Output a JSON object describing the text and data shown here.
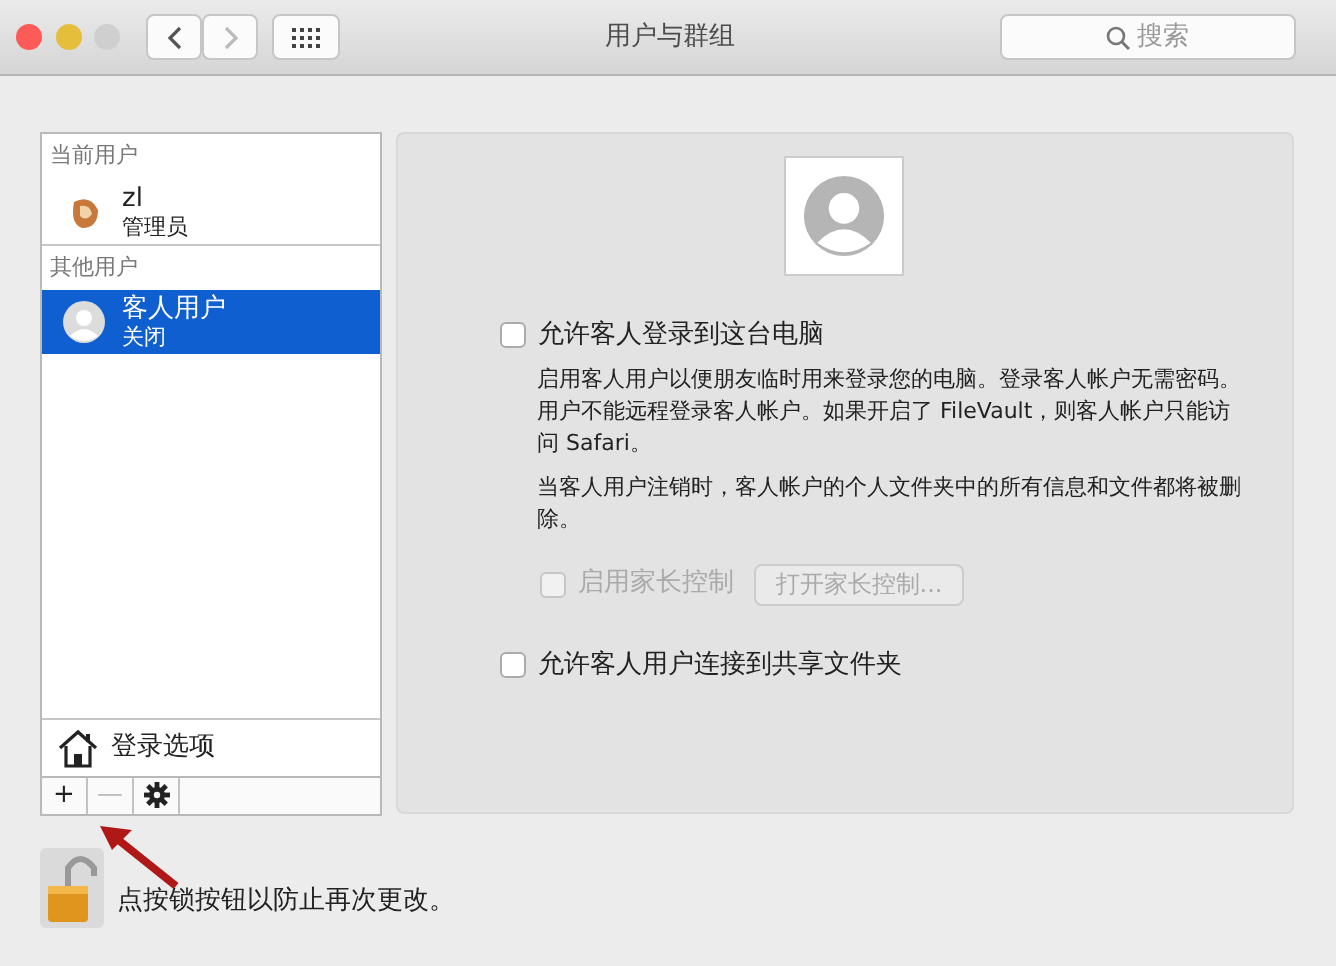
{
  "window": {
    "title": "用户与群组",
    "traffic_lights": [
      {
        "color": "#fc5b57"
      },
      {
        "color": "#e5bf3c"
      },
      {
        "color": "#cfcfcf"
      }
    ]
  },
  "toolbar": {
    "back_disabled": false,
    "forward_disabled": true,
    "search": {
      "placeholder": "搜索"
    }
  },
  "sidebar": {
    "sections": [
      {
        "heading": "当前用户",
        "items": [
          {
            "name": "zl",
            "subtitle": "管理员",
            "kind": "user",
            "selected": false
          }
        ]
      },
      {
        "heading": "其他用户",
        "items": [
          {
            "name": "客人用户",
            "subtitle": "关闭",
            "kind": "guest",
            "selected": true
          }
        ]
      }
    ],
    "login_options": "登录选项",
    "buttons": [
      {
        "kind": "text",
        "label": "+",
        "disabled": false
      },
      {
        "kind": "text",
        "label": "—",
        "disabled": true
      },
      {
        "kind": "settings",
        "disabled": false
      }
    ]
  },
  "detail": {
    "options": [
      {
        "kind": "checkbox",
        "label": "允许客人登录到这台电脑",
        "checked": false,
        "disabled": false,
        "notes": [
          "启用客人用户以便朋友临时用来登录您的电脑。登录客人帐户无需密码。用户不能远程登录客人帐户。如果开启了 FileVault，则客人帐户只能访问 Safari。",
          "当客人用户注销时，客人帐户的个人文件夹中的所有信息和文件都将被删除。"
        ]
      },
      {
        "kind": "parental",
        "label": "启用家长控制",
        "checked": false,
        "disabled": true,
        "button": "打开家长控制..."
      },
      {
        "kind": "checkbox",
        "label": "允许客人用户连接到共享文件夹",
        "checked": false,
        "disabled": false
      }
    ]
  },
  "footer": {
    "locked": false,
    "text": "点按锁按钮以防止再次更改。"
  }
}
